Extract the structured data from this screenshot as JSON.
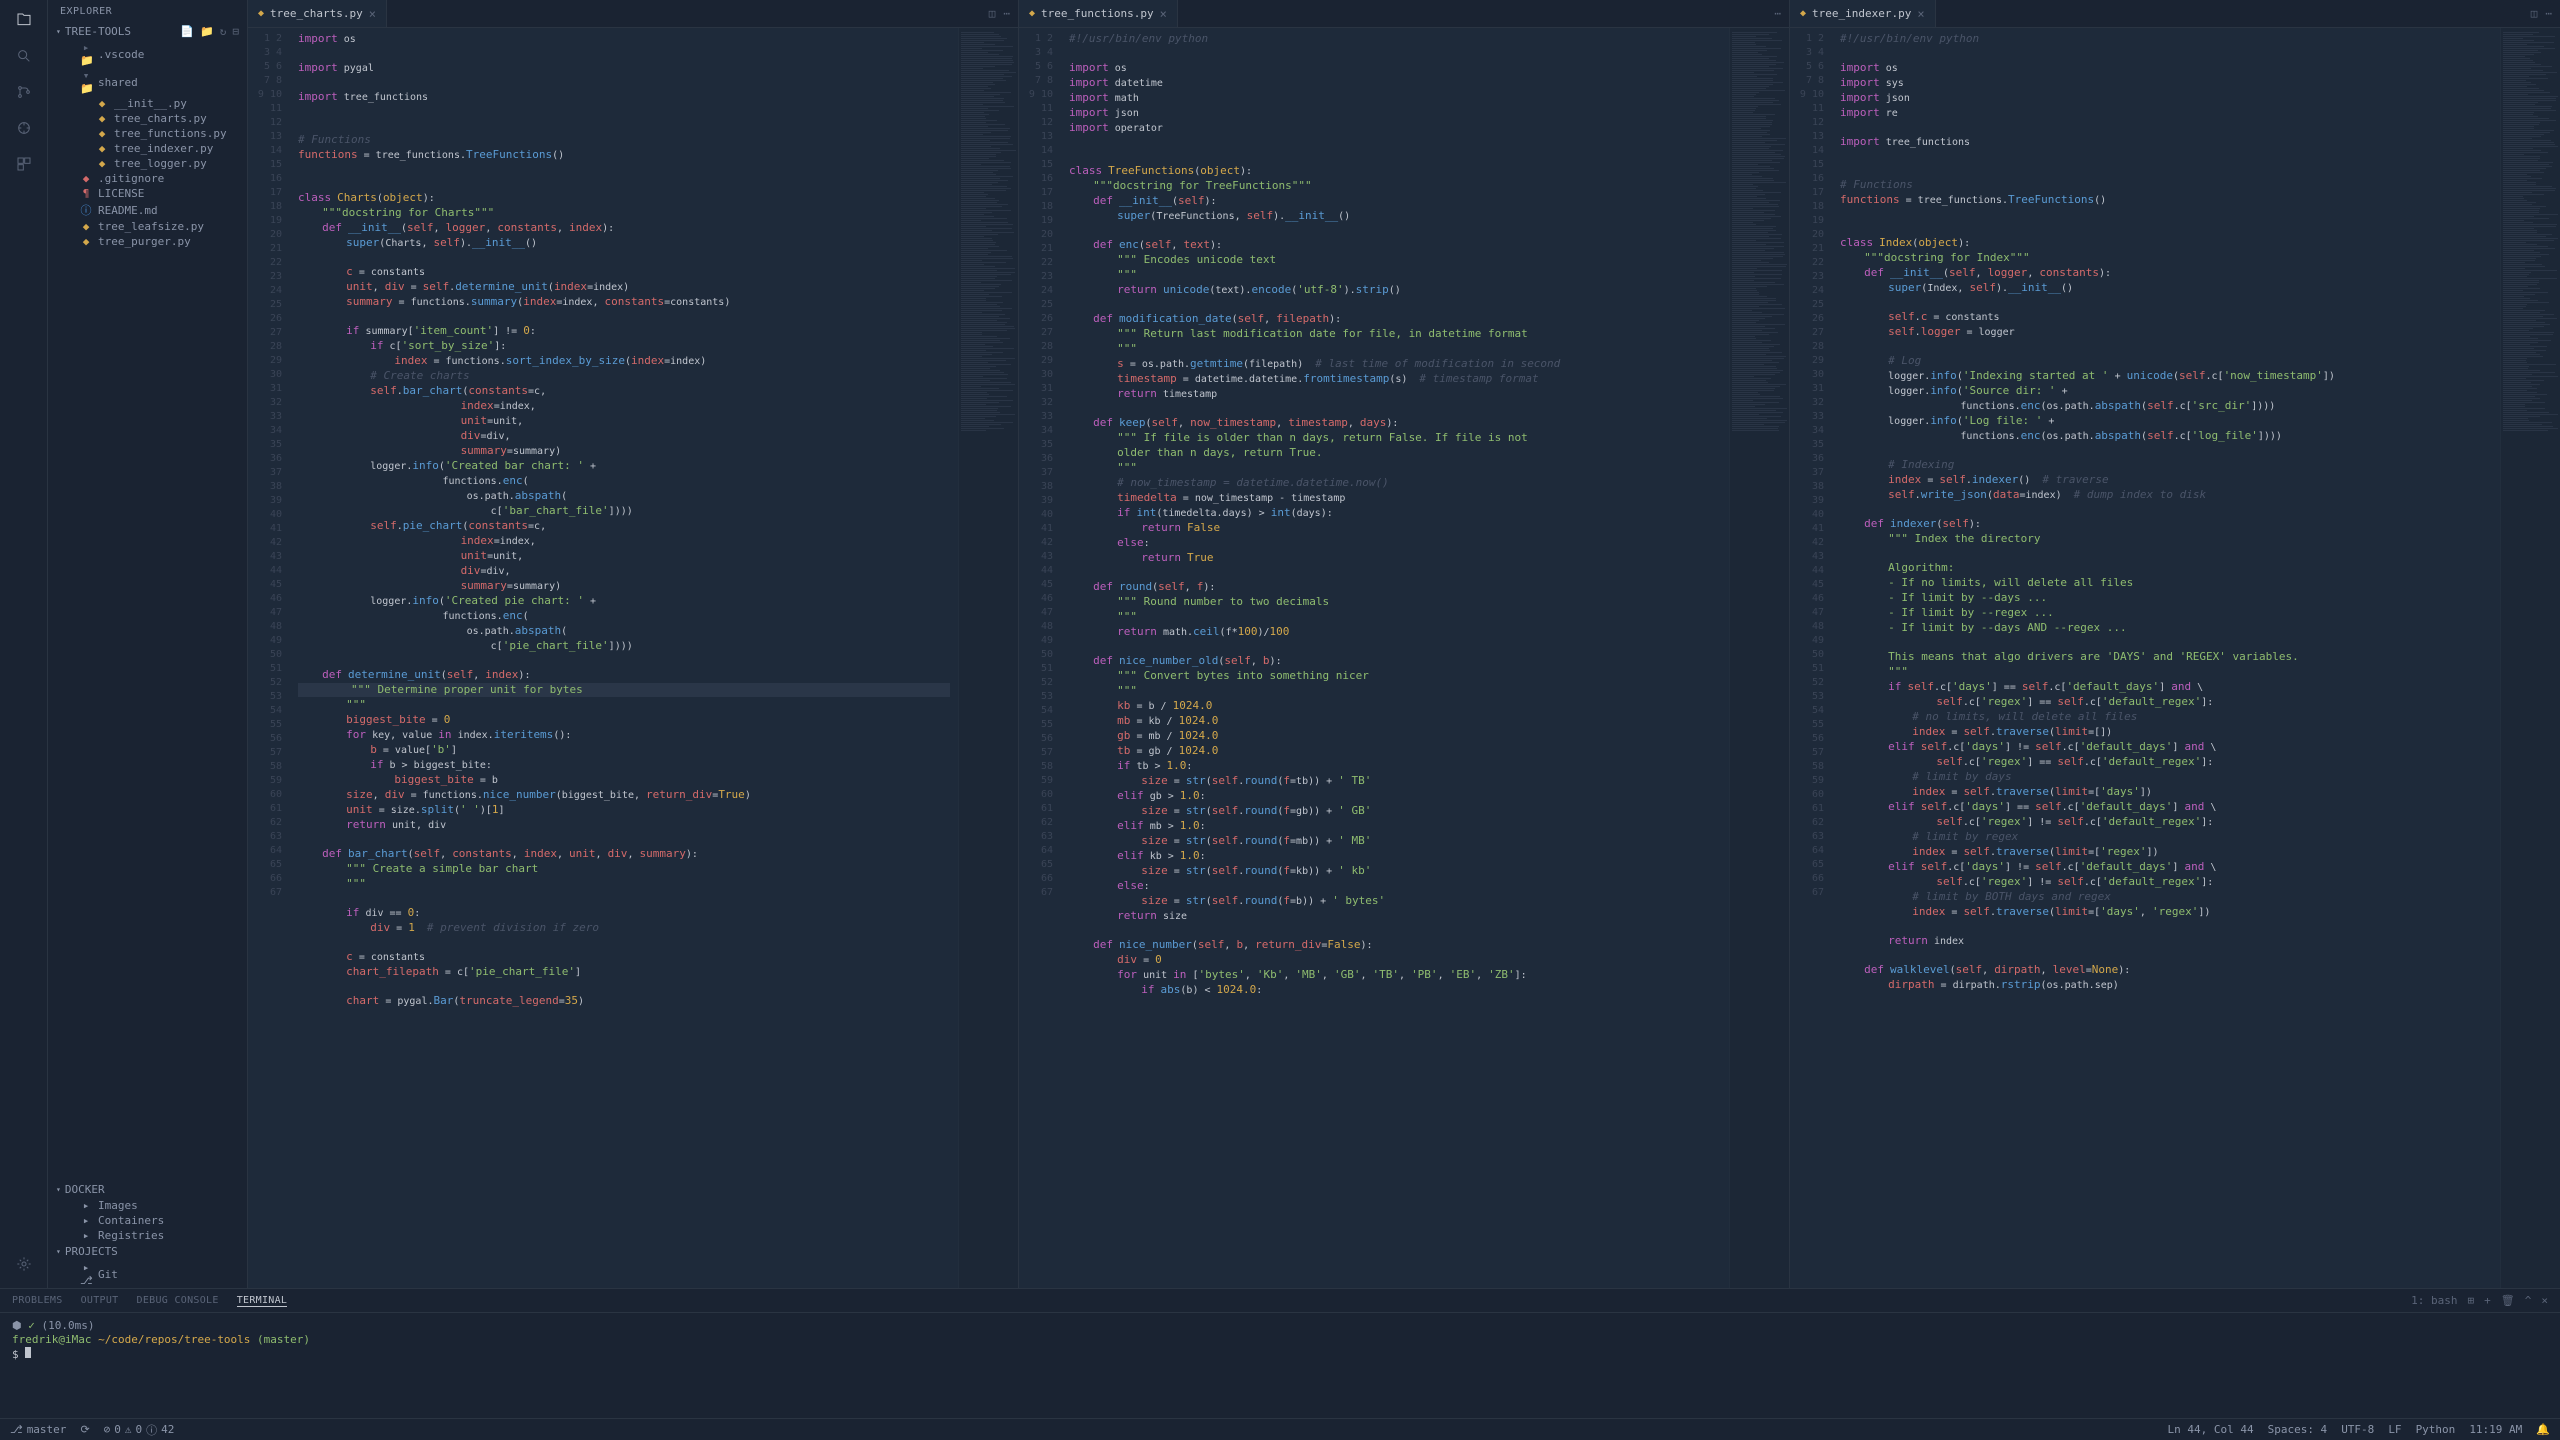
{
  "sidebar": {
    "title": "EXPLORER",
    "sections": {
      "workspace": "TREE-TOOLS",
      "docker": "DOCKER",
      "projects": "PROJECTS"
    },
    "tree": {
      "vscode": ".vscode",
      "shared": "shared",
      "init": "__init__.py",
      "charts": "tree_charts.py",
      "functions": "tree_functions.py",
      "indexer": "tree_indexer.py",
      "logger": "tree_logger.py",
      "gitignore": ".gitignore",
      "license": "LICENSE",
      "readme": "README.md",
      "leafsize": "tree_leafsize.py",
      "purger": "tree_purger.py"
    },
    "docker": {
      "images": "Images",
      "containers": "Containers",
      "registries": "Registries"
    },
    "projects": {
      "git": "Git"
    }
  },
  "tabs": {
    "pane1": "tree_charts.py",
    "pane2": "tree_functions.py",
    "pane3": "tree_indexer.py"
  },
  "panel": {
    "problems": "PROBLEMS",
    "output": "OUTPUT",
    "debug": "DEBUG CONSOLE",
    "terminal": "TERMINAL",
    "shell": "1: bash"
  },
  "terminal": {
    "line1_a": "⬢ ",
    "line1_b": "✓",
    "line1_c": " (10.0ms)",
    "line2_a": "fredrik@iMac",
    "line2_b": " ~/code/repos/tree-tools",
    "line2_c": " (master)",
    "line3": "$ "
  },
  "status": {
    "branch": "master",
    "errors": "0",
    "warnings": "0",
    "info": "42",
    "lncol": "Ln 44, Col 44",
    "spaces": "Spaces: 4",
    "encoding": "UTF-8",
    "eol": "LF",
    "lang": "Python",
    "time": "11:19 AM",
    "bell": "🔔"
  },
  "code1": "<span class='kw'>import</span> os\n\n<span class='kw'>import</span> pygal\n\n<span class='kw'>import</span> tree_functions\n\n\n<span class='cm'># Functions</span>\n<span class='pr'>functions</span> = tree_functions.<span class='fn'>TreeFunctions</span>()\n\n\n<span class='kw'>class</span> <span class='cls'>Charts</span>(<span class='cls'>object</span>):\n    <span class='str'>\"\"\"docstring for Charts\"\"\"</span>\n    <span class='kw'>def</span> <span class='fn'>__init__</span>(<span class='sl'>self</span>, <span class='pr'>logger</span>, <span class='pr'>constants</span>, <span class='pr'>index</span>):\n        <span class='fn'>super</span>(Charts, <span class='sl'>self</span>).<span class='fn'>__init__</span>()\n\n        <span class='pr'>c</span> = constants\n        <span class='pr'>unit</span>, <span class='pr'>div</span> = <span class='sl'>self</span>.<span class='fn'>determine_unit</span>(<span class='pr'>index</span>=index)\n        <span class='pr'>summary</span> = functions.<span class='fn'>summary</span>(<span class='pr'>index</span>=index, <span class='pr'>constants</span>=constants)\n\n        <span class='kw'>if</span> summary[<span class='str'>'item_count'</span>] != <span class='num'>0</span>:\n            <span class='kw'>if</span> c[<span class='str'>'sort_by_size'</span>]:\n                <span class='pr'>index</span> = functions.<span class='fn'>sort_index_by_size</span>(<span class='pr'>index</span>=index)\n            <span class='cm'># Create charts</span>\n            <span class='sl'>self</span>.<span class='fn'>bar_chart</span>(<span class='pr'>constants</span>=c,\n                           <span class='pr'>index</span>=index,\n                           <span class='pr'>unit</span>=unit,\n                           <span class='pr'>div</span>=div,\n                           <span class='pr'>summary</span>=summary)\n            logger.<span class='fn'>info</span>(<span class='str'>'Created bar chart: '</span> +\n                        functions.<span class='fn'>enc</span>(\n                            os.path.<span class='fn'>abspath</span>(\n                                c[<span class='str'>'bar_chart_file'</span>])))\n            <span class='sl'>self</span>.<span class='fn'>pie_chart</span>(<span class='pr'>constants</span>=c,\n                           <span class='pr'>index</span>=index,\n                           <span class='pr'>unit</span>=unit,\n                           <span class='pr'>div</span>=div,\n                           <span class='pr'>summary</span>=summary)\n            logger.<span class='fn'>info</span>(<span class='str'>'Created pie chart: '</span> +\n                        functions.<span class='fn'>enc</span>(\n                            os.path.<span class='fn'>abspath</span>(\n                                c[<span class='str'>'pie_chart_file'</span>])))\n\n    <span class='kw'>def</span> <span class='fn'>determine_unit</span>(<span class='sl'>self</span>, <span class='pr'>index</span>):\n<span class='highlighted'>        <span class='str'>\"\"\" Determine proper unit for bytes</span></span>\n        <span class='str'>\"\"\"</span>\n        <span class='pr'>biggest_bite</span> = <span class='num'>0</span>\n        <span class='kw'>for</span> key, value <span class='kw'>in</span> index.<span class='fn'>iteritems</span>():\n            <span class='pr'>b</span> = value[<span class='str'>'b'</span>]\n            <span class='kw'>if</span> b > biggest_bite:\n                <span class='pr'>biggest_bite</span> = b\n        <span class='pr'>size</span>, <span class='pr'>div</span> = functions.<span class='fn'>nice_number</span>(biggest_bite, <span class='pr'>return_div</span>=<span class='num'>True</span>)\n        <span class='pr'>unit</span> = size.<span class='fn'>split</span>(<span class='str'>' '</span>)[<span class='num'>1</span>]\n        <span class='kw'>return</span> unit, div\n\n    <span class='kw'>def</span> <span class='fn'>bar_chart</span>(<span class='sl'>self</span>, <span class='pr'>constants</span>, <span class='pr'>index</span>, <span class='pr'>unit</span>, <span class='pr'>div</span>, <span class='pr'>summary</span>):\n        <span class='str'>\"\"\" Create a simple bar chart</span>\n        <span class='str'>\"\"\"</span>\n\n        <span class='kw'>if</span> div == <span class='num'>0</span>:\n            <span class='pr'>div</span> = <span class='num'>1</span>  <span class='cm'># prevent division if zero</span>\n\n        <span class='pr'>c</span> = constants\n        <span class='pr'>chart_filepath</span> = c[<span class='str'>'pie_chart_file'</span>]\n\n        <span class='pr'>chart</span> = pygal.<span class='fn'>Bar</span>(<span class='pr'>truncate_legend</span>=<span class='num'>35</span>)",
  "code2": "<span class='cm'>#!/usr/bin/env python</span>\n\n<span class='kw'>import</span> os\n<span class='kw'>import</span> datetime\n<span class='kw'>import</span> math\n<span class='kw'>import</span> json\n<span class='kw'>import</span> operator\n\n\n<span class='kw'>class</span> <span class='cls'>TreeFunctions</span>(<span class='cls'>object</span>):\n    <span class='str'>\"\"\"docstring for TreeFunctions\"\"\"</span>\n    <span class='kw'>def</span> <span class='fn'>__init__</span>(<span class='sl'>self</span>):\n        <span class='fn'>super</span>(TreeFunctions, <span class='sl'>self</span>).<span class='fn'>__init__</span>()\n\n    <span class='kw'>def</span> <span class='fn'>enc</span>(<span class='sl'>self</span>, <span class='pr'>text</span>):\n        <span class='str'>\"\"\" Encodes unicode text</span>\n        <span class='str'>\"\"\"</span>\n        <span class='kw'>return</span> <span class='fn'>unicode</span>(text).<span class='fn'>encode</span>(<span class='str'>'utf-8'</span>).<span class='fn'>strip</span>()\n\n    <span class='kw'>def</span> <span class='fn'>modification_date</span>(<span class='sl'>self</span>, <span class='pr'>filepath</span>):\n        <span class='str'>\"\"\" Return last modification date for file, in datetime format</span>\n        <span class='str'>\"\"\"</span>\n        <span class='pr'>s</span> = os.path.<span class='fn'>getmtime</span>(filepath)  <span class='cm'># last time of modification in second</span>\n        <span class='pr'>timestamp</span> = datetime.datetime.<span class='fn'>fromtimestamp</span>(s)  <span class='cm'># timestamp format</span>\n        <span class='kw'>return</span> timestamp\n\n    <span class='kw'>def</span> <span class='fn'>keep</span>(<span class='sl'>self</span>, <span class='pr'>now_timestamp</span>, <span class='pr'>timestamp</span>, <span class='pr'>days</span>):\n        <span class='str'>\"\"\" If file is older than n days, return False. If file is not</span>\n        <span class='str'>older than n days, return True.</span>\n        <span class='str'>\"\"\"</span>\n        <span class='cm'># now_timestamp = datetime.datetime.now()</span>\n        <span class='pr'>timedelta</span> = now_timestamp - timestamp\n        <span class='kw'>if</span> <span class='fn'>int</span>(timedelta.days) > <span class='fn'>int</span>(days):\n            <span class='kw'>return</span> <span class='num'>False</span>\n        <span class='kw'>else</span>:\n            <span class='kw'>return</span> <span class='num'>True</span>\n\n    <span class='kw'>def</span> <span class='fn'>round</span>(<span class='sl'>self</span>, <span class='pr'>f</span>):\n        <span class='str'>\"\"\" Round number to two decimals</span>\n        <span class='str'>\"\"\"</span>\n        <span class='kw'>return</span> math.<span class='fn'>ceil</span>(f*<span class='num'>100</span>)/<span class='num'>100</span>\n\n    <span class='kw'>def</span> <span class='fn'>nice_number_old</span>(<span class='sl'>self</span>, <span class='pr'>b</span>):\n        <span class='str'>\"\"\" Convert bytes into something nicer</span>\n        <span class='str'>\"\"\"</span>\n        <span class='pr'>kb</span> = b / <span class='num'>1024.0</span>\n        <span class='pr'>mb</span> = kb / <span class='num'>1024.0</span>\n        <span class='pr'>gb</span> = mb / <span class='num'>1024.0</span>\n        <span class='pr'>tb</span> = gb / <span class='num'>1024.0</span>\n        <span class='kw'>if</span> tb > <span class='num'>1.0</span>:\n            <span class='pr'>size</span> = <span class='fn'>str</span>(<span class='sl'>self</span>.<span class='fn'>round</span>(<span class='pr'>f</span>=tb)) + <span class='str'>' TB'</span>\n        <span class='kw'>elif</span> gb > <span class='num'>1.0</span>:\n            <span class='pr'>size</span> = <span class='fn'>str</span>(<span class='sl'>self</span>.<span class='fn'>round</span>(<span class='pr'>f</span>=gb)) + <span class='str'>' GB'</span>\n        <span class='kw'>elif</span> mb > <span class='num'>1.0</span>:\n            <span class='pr'>size</span> = <span class='fn'>str</span>(<span class='sl'>self</span>.<span class='fn'>round</span>(<span class='pr'>f</span>=mb)) + <span class='str'>' MB'</span>\n        <span class='kw'>elif</span> kb > <span class='num'>1.0</span>:\n            <span class='pr'>size</span> = <span class='fn'>str</span>(<span class='sl'>self</span>.<span class='fn'>round</span>(<span class='pr'>f</span>=kb)) + <span class='str'>' kb'</span>\n        <span class='kw'>else</span>:\n            <span class='pr'>size</span> = <span class='fn'>str</span>(<span class='sl'>self</span>.<span class='fn'>round</span>(<span class='pr'>f</span>=b)) + <span class='str'>' bytes'</span>\n        <span class='kw'>return</span> size\n\n    <span class='kw'>def</span> <span class='fn'>nice_number</span>(<span class='sl'>self</span>, <span class='pr'>b</span>, <span class='pr'>return_div</span>=<span class='num'>False</span>):\n        <span class='pr'>div</span> = <span class='num'>0</span>\n        <span class='kw'>for</span> unit <span class='kw'>in</span> [<span class='str'>'bytes'</span>, <span class='str'>'Kb'</span>, <span class='str'>'MB'</span>, <span class='str'>'GB'</span>, <span class='str'>'TB'</span>, <span class='str'>'PB'</span>, <span class='str'>'EB'</span>, <span class='str'>'ZB'</span>]:\n            <span class='kw'>if</span> <span class='fn'>abs</span>(b) < <span class='num'>1024.0</span>:",
  "code3": "<span class='cm'>#!/usr/bin/env python</span>\n\n<span class='kw'>import</span> os\n<span class='kw'>import</span> sys\n<span class='kw'>import</span> json\n<span class='kw'>import</span> re\n\n<span class='kw'>import</span> tree_functions\n\n\n<span class='cm'># Functions</span>\n<span class='pr'>functions</span> = tree_functions.<span class='fn'>TreeFunctions</span>()\n\n\n<span class='kw'>class</span> <span class='cls'>Index</span>(<span class='cls'>object</span>):\n    <span class='str'>\"\"\"docstring for Index\"\"\"</span>\n    <span class='kw'>def</span> <span class='fn'>__init__</span>(<span class='sl'>self</span>, <span class='pr'>logger</span>, <span class='pr'>constants</span>):\n        <span class='fn'>super</span>(Index, <span class='sl'>self</span>).<span class='fn'>__init__</span>()\n\n        <span class='sl'>self</span>.<span class='pr'>c</span> = constants\n        <span class='sl'>self</span>.<span class='pr'>logger</span> = logger\n\n        <span class='cm'># Log</span>\n        logger.<span class='fn'>info</span>(<span class='str'>'Indexing started at '</span> + <span class='fn'>unicode</span>(<span class='sl'>self</span>.c[<span class='str'>'now_timestamp'</span>])\n        logger.<span class='fn'>info</span>(<span class='str'>'Source dir: '</span> +\n                    functions.<span class='fn'>enc</span>(os.path.<span class='fn'>abspath</span>(<span class='sl'>self</span>.c[<span class='str'>'src_dir'</span>])))\n        logger.<span class='fn'>info</span>(<span class='str'>'Log file: '</span> +\n                    functions.<span class='fn'>enc</span>(os.path.<span class='fn'>abspath</span>(<span class='sl'>self</span>.c[<span class='str'>'log_file'</span>])))\n\n        <span class='cm'># Indexing</span>\n        <span class='pr'>index</span> = <span class='sl'>self</span>.<span class='fn'>indexer</span>()  <span class='cm'># traverse</span>\n        <span class='sl'>self</span>.<span class='fn'>write_json</span>(<span class='pr'>data</span>=index)  <span class='cm'># dump index to disk</span>\n\n    <span class='kw'>def</span> <span class='fn'>indexer</span>(<span class='sl'>self</span>):\n        <span class='str'>\"\"\" Index the directory</span>\n\n        <span class='str'>Algorithm:</span>\n        <span class='str'>- If no limits, will delete all files</span>\n        <span class='str'>- If limit by --days ...</span>\n        <span class='str'>- If limit by --regex ...</span>\n        <span class='str'>- If limit by --days AND --regex ...</span>\n\n        <span class='str'>This means that algo drivers are 'DAYS' and 'REGEX' variables.</span>\n        <span class='str'>\"\"\"</span>\n        <span class='kw'>if</span> <span class='sl'>self</span>.c[<span class='str'>'days'</span>] == <span class='sl'>self</span>.c[<span class='str'>'default_days'</span>] <span class='kw'>and</span> \\\n                <span class='sl'>self</span>.c[<span class='str'>'regex'</span>] == <span class='sl'>self</span>.c[<span class='str'>'default_regex'</span>]:\n            <span class='cm'># no limits, will delete all files</span>\n            <span class='pr'>index</span> = <span class='sl'>self</span>.<span class='fn'>traverse</span>(<span class='pr'>limit</span>=[])\n        <span class='kw'>elif</span> <span class='sl'>self</span>.c[<span class='str'>'days'</span>] != <span class='sl'>self</span>.c[<span class='str'>'default_days'</span>] <span class='kw'>and</span> \\\n                <span class='sl'>self</span>.c[<span class='str'>'regex'</span>] == <span class='sl'>self</span>.c[<span class='str'>'default_regex'</span>]:\n            <span class='cm'># limit by days</span>\n            <span class='pr'>index</span> = <span class='sl'>self</span>.<span class='fn'>traverse</span>(<span class='pr'>limit</span>=[<span class='str'>'days'</span>])\n        <span class='kw'>elif</span> <span class='sl'>self</span>.c[<span class='str'>'days'</span>] == <span class='sl'>self</span>.c[<span class='str'>'default_days'</span>] <span class='kw'>and</span> \\\n                <span class='sl'>self</span>.c[<span class='str'>'regex'</span>] != <span class='sl'>self</span>.c[<span class='str'>'default_regex'</span>]:\n            <span class='cm'># limit by regex</span>\n            <span class='pr'>index</span> = <span class='sl'>self</span>.<span class='fn'>traverse</span>(<span class='pr'>limit</span>=[<span class='str'>'regex'</span>])\n        <span class='kw'>elif</span> <span class='sl'>self</span>.c[<span class='str'>'days'</span>] != <span class='sl'>self</span>.c[<span class='str'>'default_days'</span>] <span class='kw'>and</span> \\\n                <span class='sl'>self</span>.c[<span class='str'>'regex'</span>] != <span class='sl'>self</span>.c[<span class='str'>'default_regex'</span>]:\n            <span class='cm'># limit by BOTH days and regex</span>\n            <span class='pr'>index</span> = <span class='sl'>self</span>.<span class='fn'>traverse</span>(<span class='pr'>limit</span>=[<span class='str'>'days'</span>, <span class='str'>'regex'</span>])\n\n        <span class='kw'>return</span> index\n\n    <span class='kw'>def</span> <span class='fn'>walklevel</span>(<span class='sl'>self</span>, <span class='pr'>dirpath</span>, <span class='pr'>level</span>=<span class='num'>None</span>):\n        <span class='pr'>dirpath</span> = dirpath.<span class='fn'>rstrip</span>(os.path.sep)"
}
